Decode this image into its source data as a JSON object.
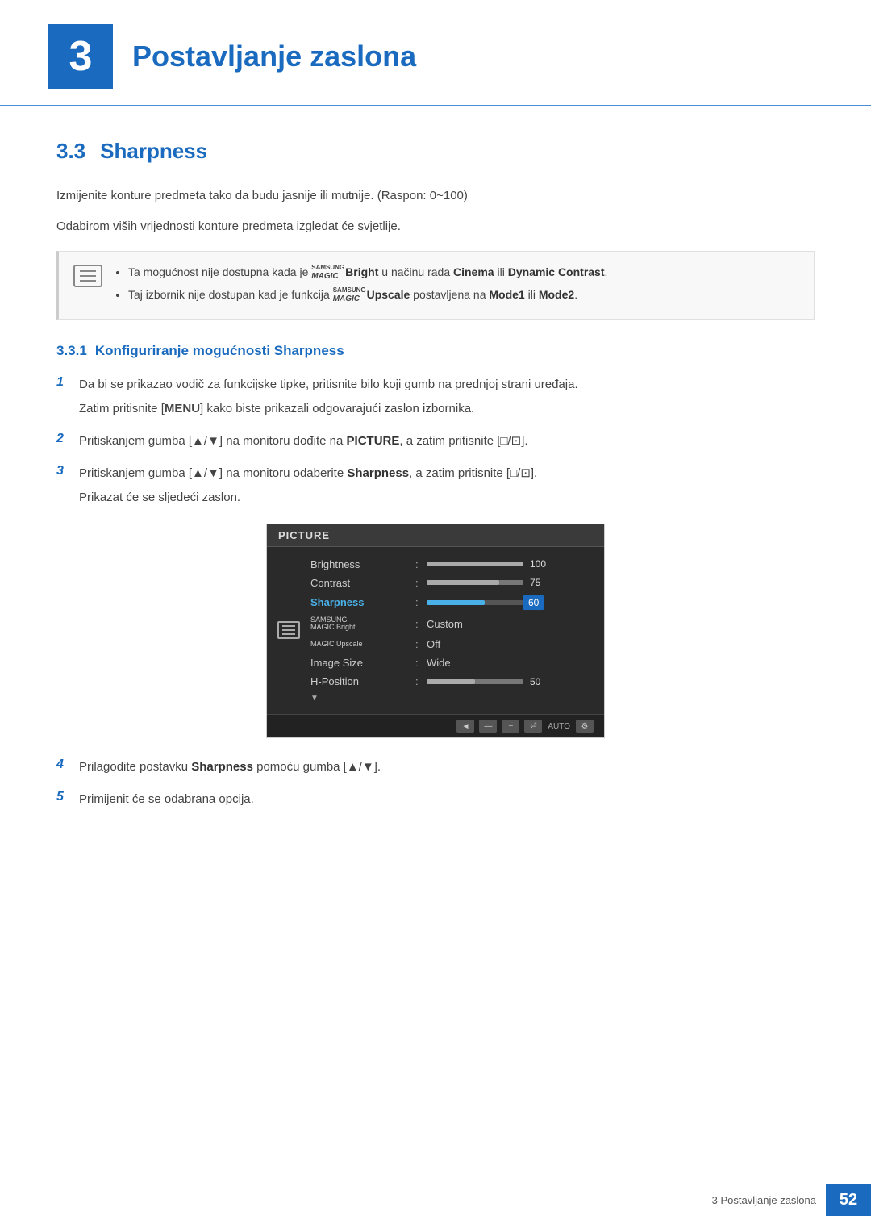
{
  "header": {
    "chapter_number": "3",
    "title": "Postavljanje zaslona"
  },
  "section": {
    "number": "3.3",
    "title": "Sharpness"
  },
  "intro_paragraphs": [
    "Izmijenite konture predmeta tako da budu jasnije ili mutnije. (Raspon: 0~100)",
    "Odabirom viših vrijednosti konture predmeta izgledat će svjetlije."
  ],
  "notes": [
    "Ta mogućnost nije dostupna kada je SAMSUNGBright u načinu rada Cinema ili Dynamic Contrast.",
    "Taj izbornik nije dostupan kad je funkcija SAMSUNGUpscale postavljena na Mode1 ili Mode2."
  ],
  "subsection": {
    "number": "3.3.1",
    "title": "Konfiguriranje mogućnosti Sharpness"
  },
  "steps": [
    {
      "number": "1",
      "main": "Da bi se prikazao vodič za funkcijske tipke, pritisnite bilo koji gumb na prednjoj strani uređaja.",
      "sub": "Zatim pritisnite [MENU] kako biste prikazali odgovarajući zaslon izbornika."
    },
    {
      "number": "2",
      "main": "Pritiskanjem gumba [▲/▼] na monitoru dođite na PICTURE, a zatim pritisnite [□/⊡]."
    },
    {
      "number": "3",
      "main": "Pritiskanjem gumba [▲/▼] na monitoru odaberite Sharpness, a zatim pritisnite [□/⊡].",
      "sub": "Prikazat će se sljedeći zaslon."
    },
    {
      "number": "4",
      "main": "Prilagodite postavku Sharpness pomoću gumba [▲/▼]."
    },
    {
      "number": "5",
      "main": "Primijenit će se odabrana opcija."
    }
  ],
  "menu_screenshot": {
    "title": "PICTURE",
    "items": [
      {
        "label": "Brightness",
        "type": "bar",
        "fill": 100,
        "max": 100,
        "value": "100"
      },
      {
        "label": "Contrast",
        "type": "bar",
        "fill": 75,
        "max": 100,
        "value": "75"
      },
      {
        "label": "Sharpness",
        "type": "bar_highlight",
        "fill": 60,
        "max": 100,
        "value": "60",
        "active": true
      },
      {
        "label": "SAMSUNG MAGIC Bright",
        "type": "text",
        "value": "Custom"
      },
      {
        "label": "MAGIC Upscale",
        "type": "text",
        "value": "Off"
      },
      {
        "label": "Image Size",
        "type": "text",
        "value": "Wide"
      },
      {
        "label": "H-Position",
        "type": "bar",
        "fill": 50,
        "max": 100,
        "value": "50"
      }
    ]
  },
  "footer": {
    "text": "3 Postavljanje zaslona",
    "page": "52"
  }
}
